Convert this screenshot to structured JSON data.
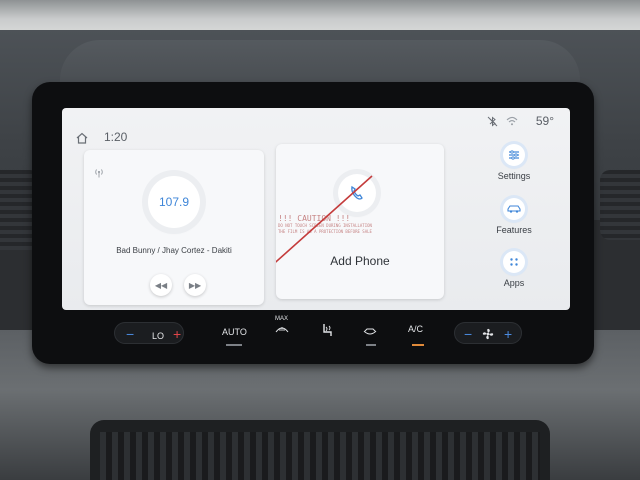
{
  "status": {
    "time": "1:20",
    "temperature": "59°",
    "icons": [
      "home-icon",
      "bluetooth-off-icon",
      "wifi-icon"
    ]
  },
  "radio": {
    "frequency": "107.9",
    "now_playing": "Bad Bunny / Jhay Cortez - Dakiti",
    "icons": [
      "signal-icon",
      "previous-track-icon",
      "next-track-icon"
    ]
  },
  "phone": {
    "label": "Add Phone",
    "sticker_lines": [
      "!!! CAUTION !!!",
      "DO NOT TOUCH SCREEN DURING INSTALLATION",
      "THE FILM IS AS A PROTECTION BEFORE SALE"
    ]
  },
  "nav": [
    {
      "label": "Settings",
      "icon": "settings-icon"
    },
    {
      "label": "Features",
      "icon": "car-icon"
    },
    {
      "label": "Apps",
      "icon": "apps-grid-icon"
    }
  ],
  "climate": {
    "driver_temp": "LO",
    "auto_label": "AUTO",
    "max_label": "MAX",
    "ac_label": "A/C",
    "icons": [
      "max-defrost-icon",
      "seat-heat-icon",
      "recirculate-icon",
      "fan-icon"
    ]
  },
  "colors": {
    "accent": "#3f86d8",
    "minus_blue": "#4b8be0",
    "plus_red": "#e0464a",
    "screen_bg": "#eef0f2"
  }
}
